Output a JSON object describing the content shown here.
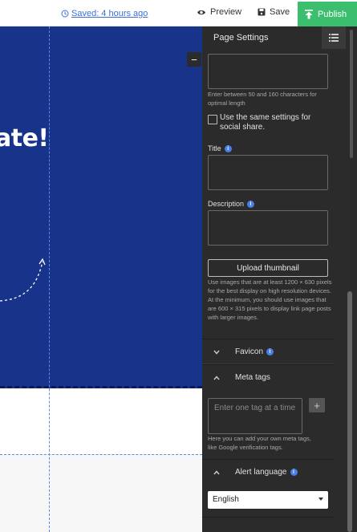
{
  "topbar": {
    "saved_label": "Saved: 4 hours ago",
    "preview_label": "Preview",
    "save_label": "Save",
    "publish_label": "Publish"
  },
  "canvas": {
    "hero_text": "ate!",
    "collapse_label": "−"
  },
  "panel": {
    "title": "Page Settings",
    "seo_description_hint": "Enter between 50 and 160 characters for optimal length",
    "same_settings_label": "Use the same settings for social share.",
    "title_label": "Title",
    "description_label": "Description",
    "upload_label": "Upload thumbnail",
    "upload_hint": "Use images that are at least 1200 × 630 pixels for the best display on high resolution devices. At the minimum, you should use images that are 600 × 315 pixels to display link page posts with larger images.",
    "sections": {
      "favicon": "Favicon",
      "meta_tags": "Meta tags",
      "alert_language": "Alert language"
    },
    "meta_placeholder": "Enter one tag at a time",
    "meta_plus": "+",
    "meta_hint": "Here you can add your own meta tags, like Google verification tags.",
    "language_value": "English"
  },
  "colors": {
    "hero_bg": "#17338a",
    "publish_bg": "#3bbf6e",
    "panel_bg": "#2b2b2b",
    "link": "#3c6fd8",
    "info": "#4a7ee8"
  },
  "icons": [
    "history-icon",
    "eye-icon",
    "floppy-icon",
    "upload-arrow-icon",
    "list-icon",
    "chevron-down-icon",
    "chevron-up-icon",
    "info-icon"
  ]
}
